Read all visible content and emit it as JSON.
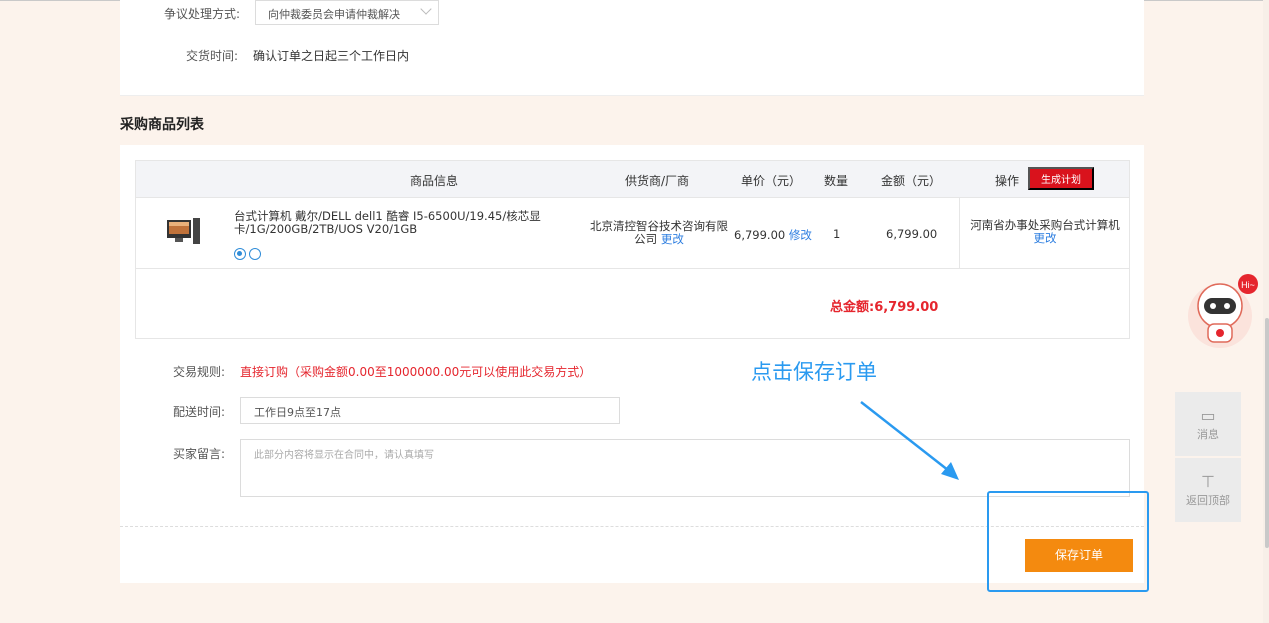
{
  "top_form": {
    "dispute_label": "争议处理方式:",
    "dispute_value": "向仲裁委员会申请仲裁解决",
    "delivery_label": "交货时间:",
    "delivery_value": "确认订单之日起三个工作日内"
  },
  "section_title": "采购商品列表",
  "table": {
    "headers": {
      "product": "商品信息",
      "supplier": "供货商/厂商",
      "price": "单价（元）",
      "qty": "数量",
      "amount": "金额（元）",
      "operation": "操作"
    },
    "generate_plan_label": "生成计划",
    "row": {
      "name": "台式计算机 戴尔/DELL dell1 酷睿 I5-6500U/19.45/核芯显卡/1G/200GB/2TB/UOS V20/1GB",
      "supplier": "北京清控智谷技术咨询有限公司",
      "supplier_change": "更改",
      "price": "6,799.00",
      "price_edit": "修改",
      "qty": "1",
      "amount": "6,799.00",
      "operation": "河南省办事处采购台式计算机",
      "operation_change": "更改"
    },
    "total": "总金额:6,799.00"
  },
  "form": {
    "rule_label": "交易规则:",
    "rule_value": "直接订购（采购金额0.00至1000000.00元可以使用此交易方式）",
    "delivery_time_label": "配送时间:",
    "delivery_time_value": "工作日9点至17点",
    "message_label": "买家留言:",
    "message_placeholder": "此部分内容将显示在合同中，请认真填写"
  },
  "save_button": "保存订单",
  "annotation": "点击保存订单",
  "side_panel": {
    "message": "消息",
    "back_top": "返回顶部"
  },
  "robot_badge": "Hi~",
  "colors": {
    "accent_red": "#e5262e",
    "save_orange": "#f48a0f",
    "link_blue": "#2f7fe0",
    "annotation_blue": "#2a9af0"
  }
}
